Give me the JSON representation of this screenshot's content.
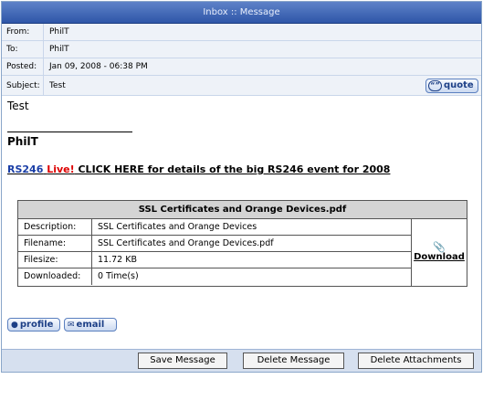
{
  "title": "Inbox :: Message",
  "header": {
    "from_label": "From:",
    "from_value": "PhilT",
    "to_label": "To:",
    "to_value": "PhilT",
    "posted_label": "Posted:",
    "posted_value": "Jan 09, 2008 - 06:38 PM",
    "subject_label": "Subject:",
    "subject_value": "Test",
    "quote_label": "quote"
  },
  "body": {
    "text": "Test",
    "signature": "PhilT",
    "promo": {
      "part1": "RS246",
      "part2": "Live!",
      "part3": "CLICK HERE for details of the big RS246 event for 2008"
    }
  },
  "attachment": {
    "name": "SSL Certificates and Orange Devices.pdf",
    "rows": [
      {
        "label": "Description:",
        "value": "SSL Certificates and Orange Devices"
      },
      {
        "label": "Filename:",
        "value": "SSL Certificates and Orange Devices.pdf"
      },
      {
        "label": "Filesize:",
        "value": "11.72 KB"
      },
      {
        "label": "Downloaded:",
        "value": "0 Time(s)"
      }
    ],
    "download_label": "Download"
  },
  "profile_label": "profile",
  "email_label": "email",
  "footer": {
    "save": "Save Message",
    "delete": "Delete Message",
    "delete_attachments": "Delete Attachments"
  },
  "colors": {
    "titlebar": "#2f56a8",
    "promo_link": "#1a3ea6",
    "live": "#dd0000"
  }
}
